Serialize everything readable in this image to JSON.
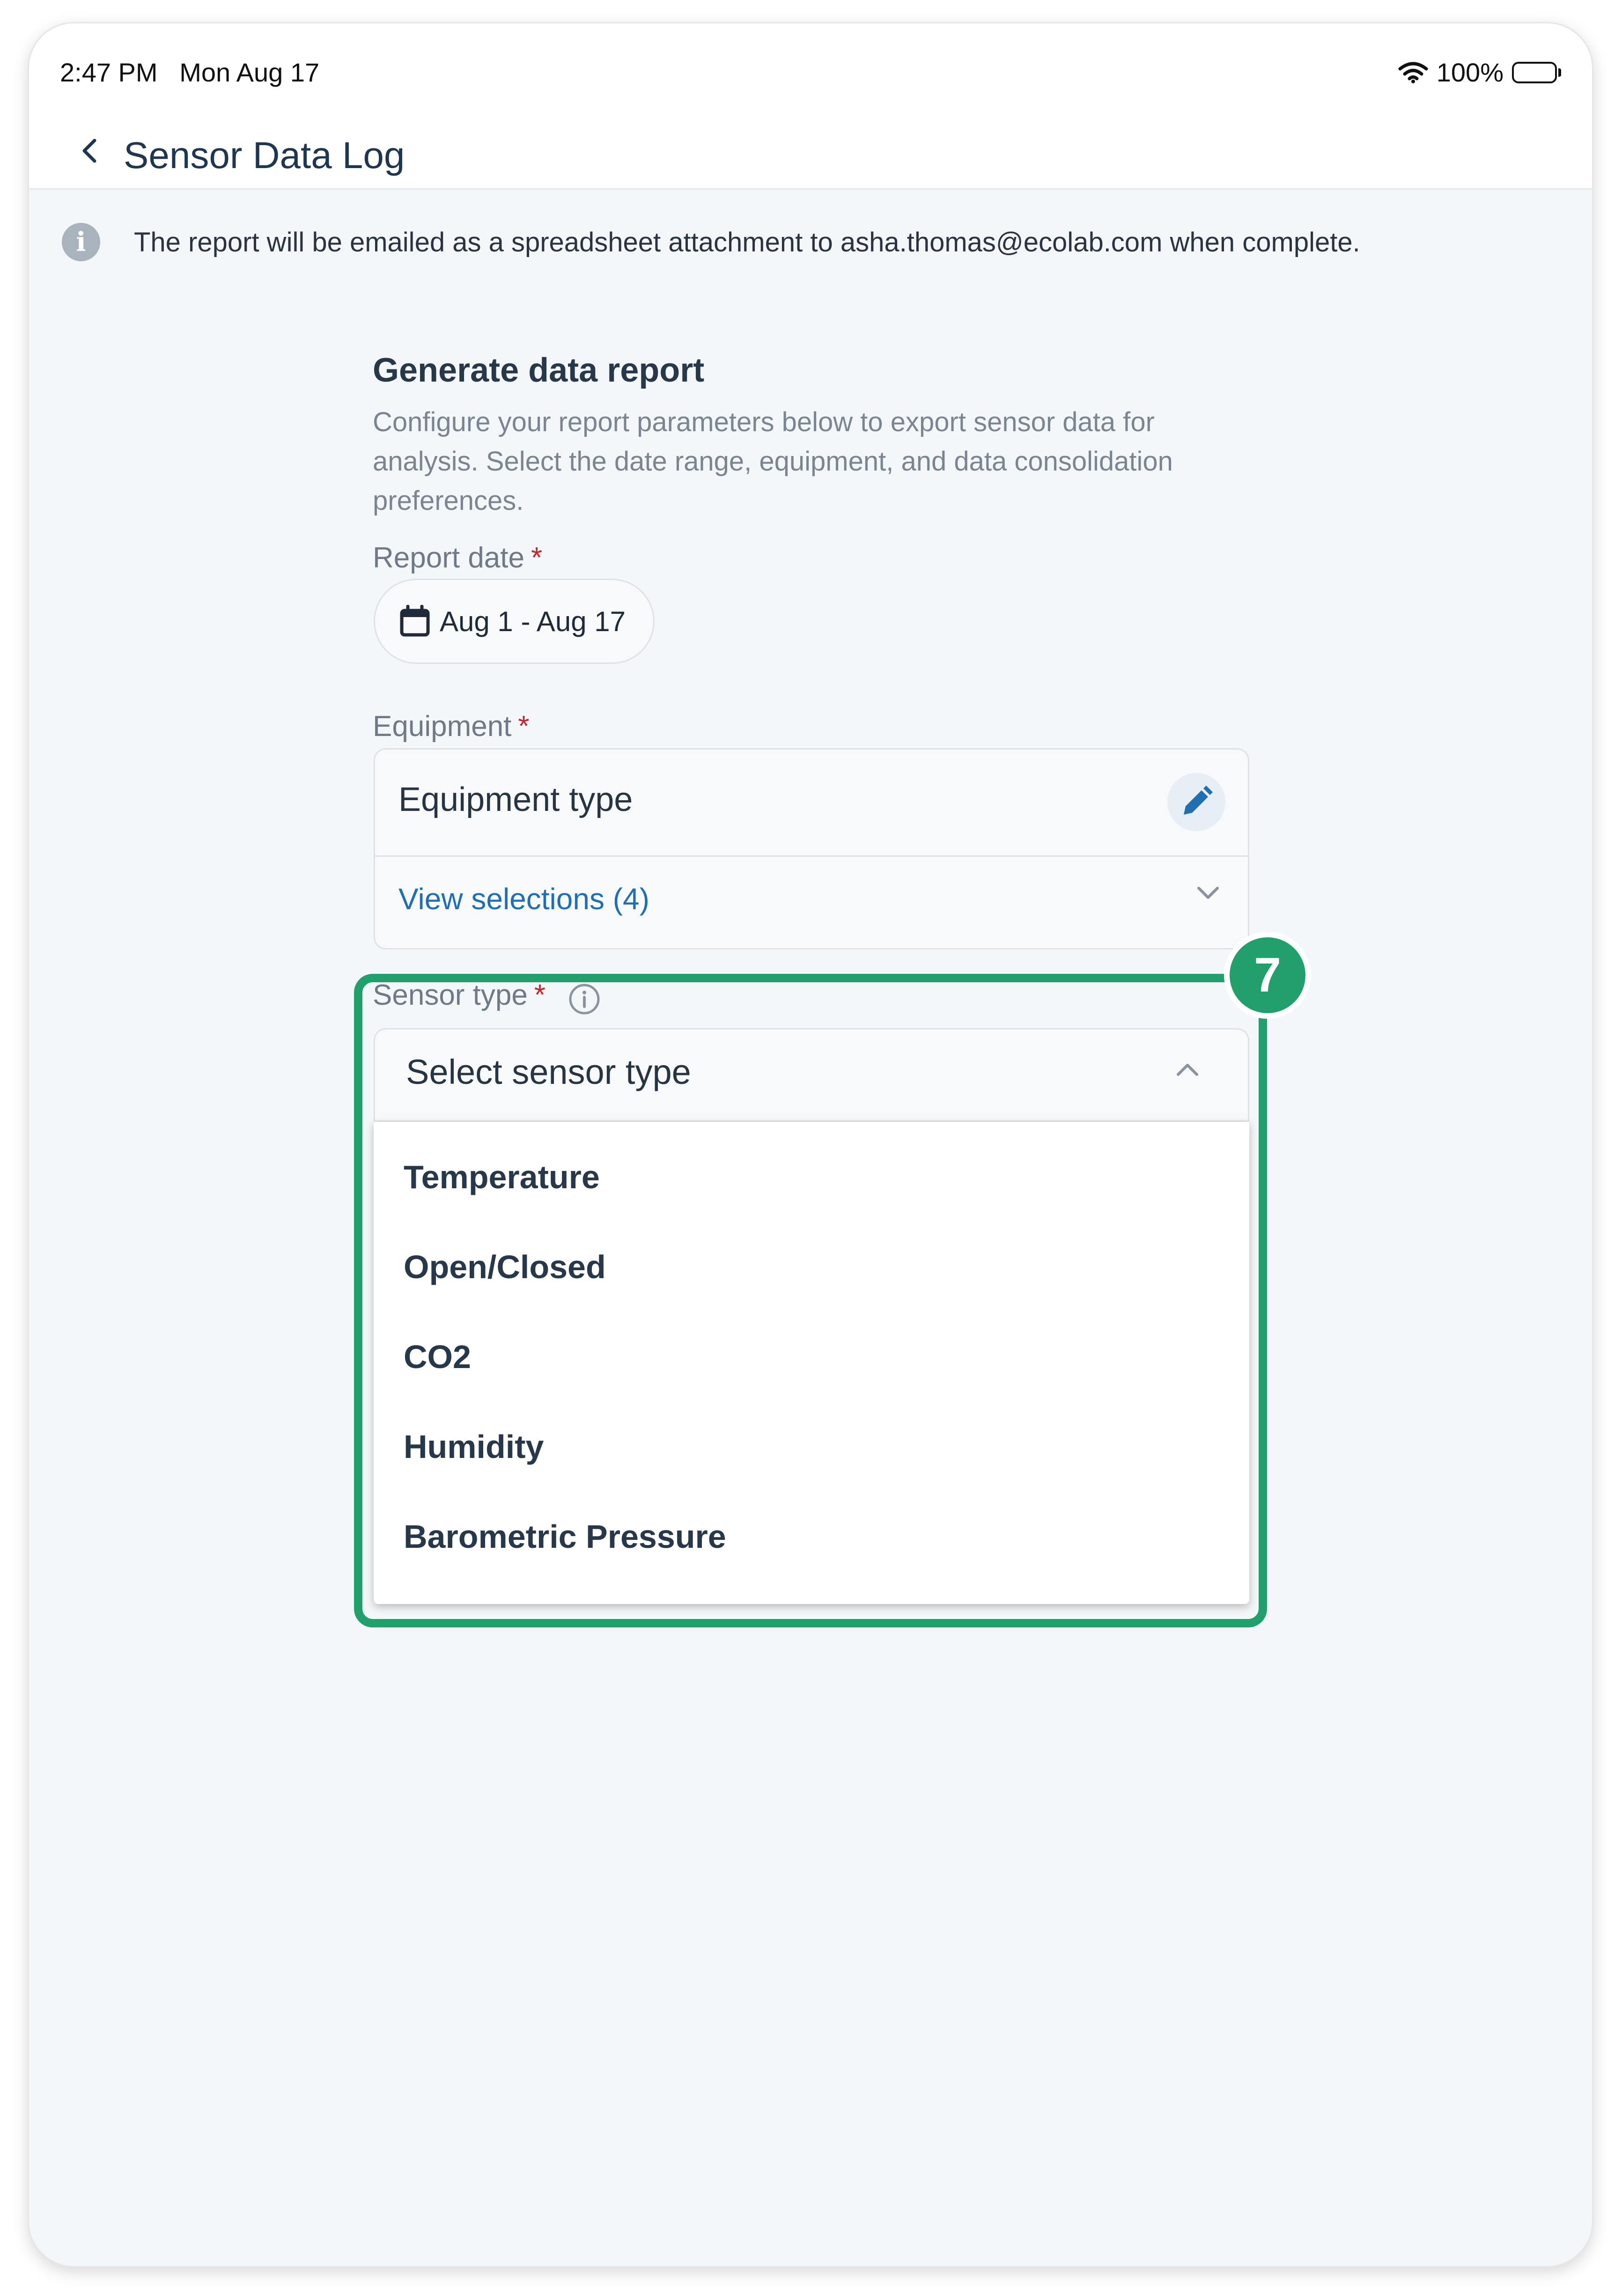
{
  "status_bar": {
    "time": "2:47 PM",
    "date": "Mon Aug 17",
    "battery": "100%"
  },
  "header": {
    "title": "Sensor Data Log"
  },
  "info_banner": {
    "text": "The report will be emailed as a spreadsheet attachment to asha.thomas@ecolab.com when complete."
  },
  "form": {
    "heading": "Generate data report",
    "description": "Configure your report parameters below to export sensor data for analysis. Select the date range, equipment, and data consolidation preferences.",
    "report_date": {
      "label": "Report date",
      "required_mark": "*",
      "value": "Aug 1 - Aug 17"
    },
    "equipment": {
      "label": "Equipment",
      "required_mark": "*",
      "field_value": "Equipment type",
      "view_selections": "View selections (4)"
    },
    "sensor_type": {
      "label": "Sensor type",
      "required_mark": "*",
      "placeholder": "Select sensor type",
      "options": [
        "Temperature",
        "Open/Closed",
        "CO2",
        "Humidity",
        "Barometric Pressure"
      ]
    }
  },
  "annotation": {
    "step": "7",
    "color": "#22a06b"
  },
  "colors": {
    "accent_blue": "#1f6fb2",
    "required_red": "#c2272d",
    "highlight_green": "#22a06b"
  }
}
